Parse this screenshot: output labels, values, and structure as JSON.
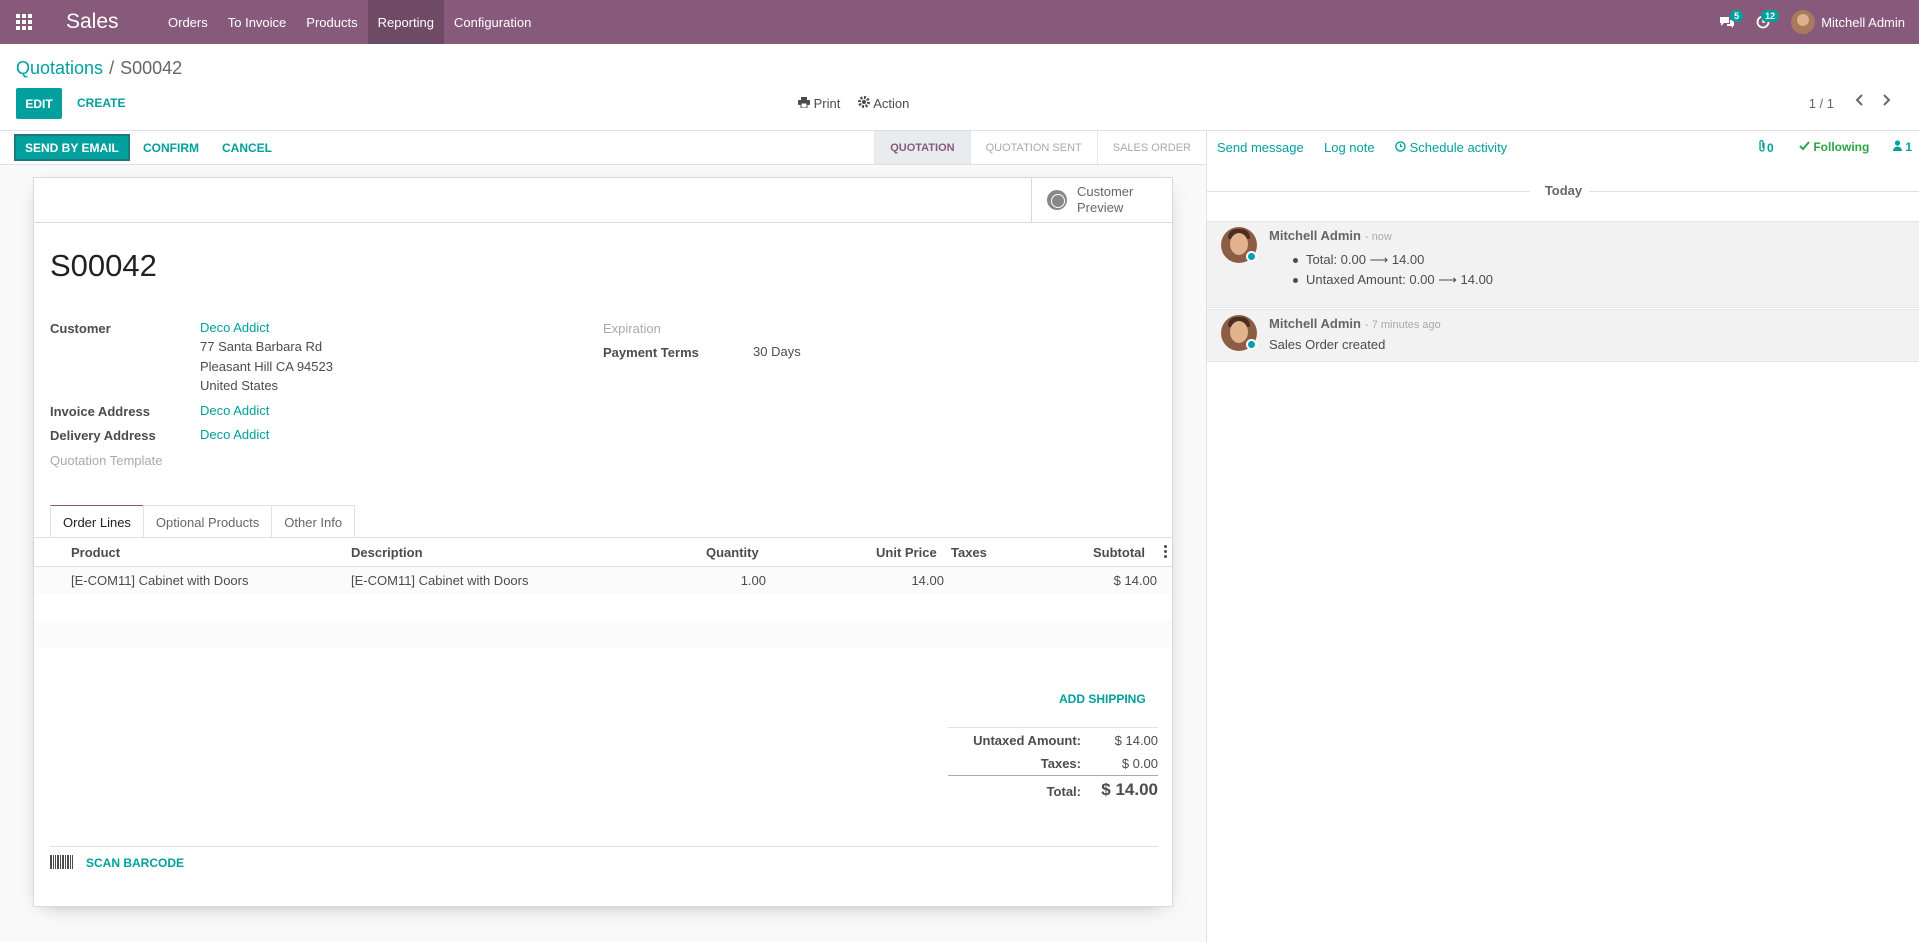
{
  "navbar": {
    "brand": "Sales",
    "menu": [
      "Orders",
      "To Invoice",
      "Products",
      "Reporting",
      "Configuration"
    ],
    "active_menu": "Reporting",
    "messages_count": "5",
    "activities_count": "12",
    "user_name": "Mitchell Admin"
  },
  "control_panel": {
    "breadcrumb_parent": "Quotations",
    "breadcrumb_separator": "/",
    "breadcrumb_current": "S00042",
    "edit_label": "EDIT",
    "create_label": "CREATE",
    "print_label": "Print",
    "action_label": "Action",
    "pager": "1 / 1"
  },
  "statusbar": {
    "send_email_label": "SEND BY EMAIL",
    "confirm_label": "CONFIRM",
    "cancel_label": "CANCEL",
    "stages": [
      "QUOTATION",
      "QUOTATION SENT",
      "SALES ORDER"
    ],
    "current_stage": "QUOTATION"
  },
  "form": {
    "preview_line1": "Customer",
    "preview_line2": "Preview",
    "title": "S00042",
    "customer_label": "Customer",
    "customer_name": "Deco Addict",
    "customer_address": [
      "77 Santa Barbara Rd",
      "Pleasant Hill CA 94523",
      "United States"
    ],
    "invoice_address_label": "Invoice Address",
    "invoice_address": "Deco Addict",
    "delivery_address_label": "Delivery Address",
    "delivery_address": "Deco Addict",
    "quotation_template_label": "Quotation Template",
    "expiration_label": "Expiration",
    "payment_terms_label": "Payment Terms",
    "payment_terms": "30 Days",
    "tabs": [
      "Order Lines",
      "Optional Products",
      "Other Info"
    ],
    "table": {
      "headers": [
        "Product",
        "Description",
        "Quantity",
        "Unit Price",
        "Taxes",
        "Subtotal"
      ],
      "rows": [
        {
          "product": "[E-COM11] Cabinet with Doors",
          "description": "[E-COM11] Cabinet with Doors",
          "quantity": "1.00",
          "unit_price": "14.00",
          "taxes": "",
          "subtotal": "$ 14.00"
        }
      ]
    },
    "add_shipping_label": "ADD SHIPPING",
    "totals": {
      "untaxed_label": "Untaxed Amount:",
      "untaxed_value": "$ 14.00",
      "taxes_label": "Taxes:",
      "taxes_value": "$ 0.00",
      "total_label": "Total:",
      "total_value": "$ 14.00"
    },
    "scan_barcode_label": "SCAN BARCODE"
  },
  "chatter": {
    "send_message": "Send message",
    "log_note": "Log note",
    "schedule_activity": "Schedule activity",
    "attachments_count": "0",
    "following_label": "Following",
    "followers_count": "1",
    "today_label": "Today",
    "messages": [
      {
        "author": "Mitchell Admin",
        "time": "- now",
        "changes": [
          "Total: 0.00 ⟶ 14.00",
          "Untaxed Amount: 0.00 ⟶ 14.00"
        ]
      },
      {
        "author": "Mitchell Admin",
        "time": "- 7 minutes ago",
        "body": "Sales Order created"
      }
    ]
  },
  "colors": {
    "brand": "#875a7b",
    "accent": "#00a09d"
  }
}
